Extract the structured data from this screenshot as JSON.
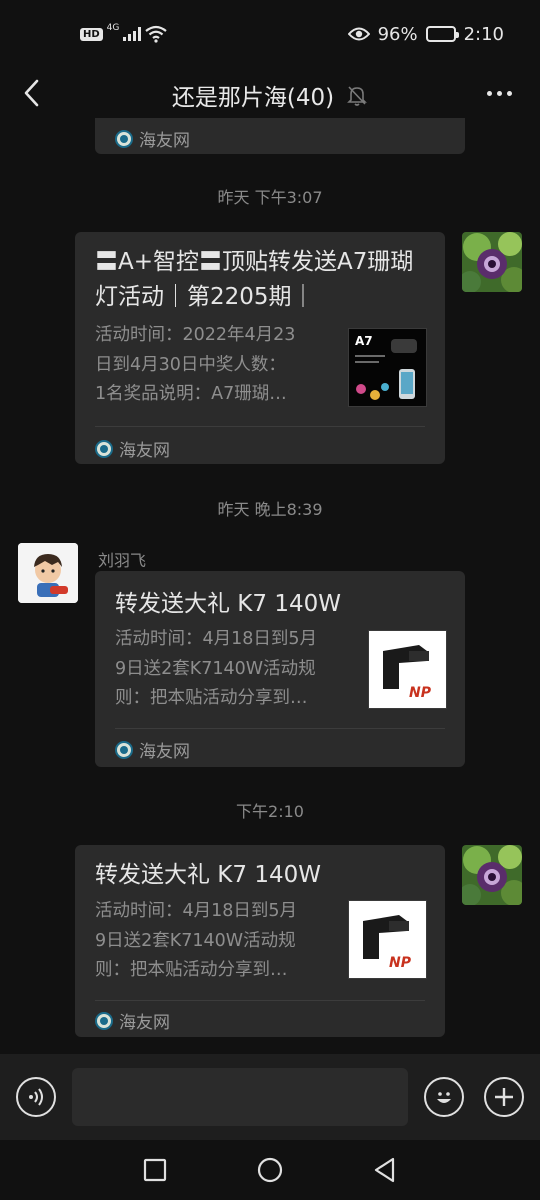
{
  "status_bar": {
    "hd_label": "HD",
    "network_label": "4G",
    "battery_percent": "96%",
    "battery_level": 0.96,
    "time": "2:10",
    "icons": [
      "signal-icon",
      "wifi-icon",
      "eye-icon",
      "battery-icon"
    ]
  },
  "header": {
    "title": "还是那片海(40)",
    "icons": [
      "back-arrow-icon",
      "mute-bell-icon",
      "more-dots-icon"
    ]
  },
  "chat": {
    "top_partial_card": {
      "source": "海友网"
    },
    "messages": [
      {
        "timestamp": "昨天 下午3:07",
        "sender": "self",
        "title": "〓A+智控〓顶贴转发送A7珊瑚灯活动｜第2205期｜",
        "desc_lines": [
          "活动时间：2022年4月23",
          "日到4月30日中奖人数：",
          "1名奖品说明：A7珊瑚…"
        ],
        "thumb_label": "A7",
        "source": "海友网"
      },
      {
        "timestamp": "昨天 晚上8:39",
        "sender": "刘羽飞",
        "title": "转发送大礼 K7 140W",
        "desc_lines": [
          "活动时间：4月18日到5月",
          "9日送2套K7140W活动规",
          "则：把本贴活动分享到…"
        ],
        "thumb_label": "NP",
        "source": "海友网"
      },
      {
        "timestamp": "下午2:10",
        "sender": "self",
        "title": "转发送大礼 K7 140W",
        "desc_lines": [
          "活动时间：4月18日到5月",
          "9日送2套K7140W活动规",
          "则：把本贴活动分享到…"
        ],
        "thumb_label": "NP",
        "source": "海友网"
      }
    ]
  },
  "input_bar": {
    "placeholder": "",
    "icons": [
      "voice-icon",
      "emoji-icon",
      "plus-icon"
    ]
  },
  "nav_bar": {
    "icons": [
      "recent-apps-icon",
      "home-icon",
      "back-triangle-icon"
    ]
  },
  "colors": {
    "background": "#111111",
    "bubble": "#2b2b2b",
    "input_bar": "#1e1e1e",
    "text_primary": "#e6e6e6",
    "text_secondary": "#8e8e8e"
  }
}
